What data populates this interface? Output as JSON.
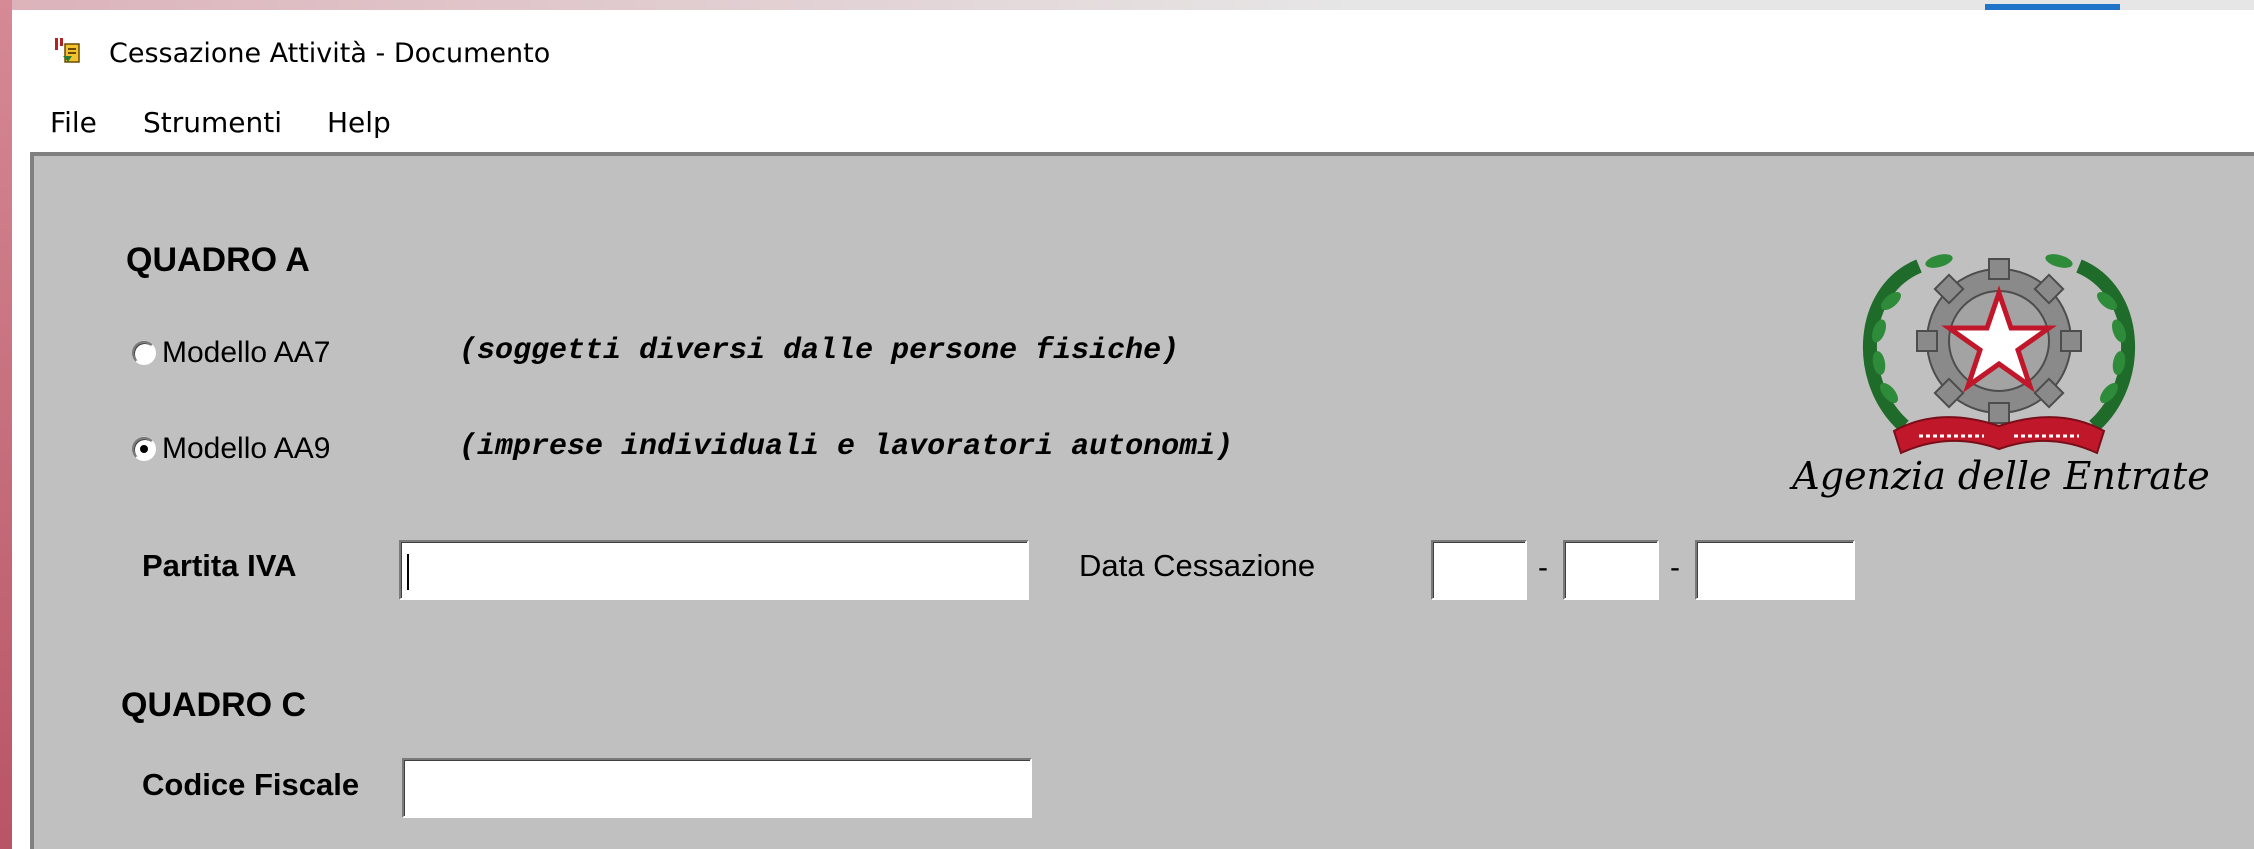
{
  "window": {
    "title": "Cessazione Attività - Documento",
    "icon": "form-document-icon"
  },
  "menu": {
    "items": [
      "File",
      "Strumenti",
      "Help"
    ]
  },
  "quadro_a": {
    "title": "QUADRO A",
    "options": [
      {
        "label": "Modello AA7",
        "note": "(soggetti diversi dalle persone fisiche)",
        "checked": false
      },
      {
        "label": "Modello AA9",
        "note": "(imprese individuali e lavoratori autonomi)",
        "checked": true
      }
    ],
    "partita_iva": {
      "label": "Partita IVA",
      "value": ""
    },
    "data_cessazione": {
      "label": "Data Cessazione",
      "day": "",
      "month": "",
      "year": "",
      "separator": "-"
    }
  },
  "quadro_c": {
    "title": "QUADRO C",
    "codice_fiscale": {
      "label": "Codice Fiscale",
      "value": ""
    }
  },
  "logo": {
    "caption": "Agenzia delle Entrate",
    "icon": "italian-republic-emblem-icon"
  }
}
